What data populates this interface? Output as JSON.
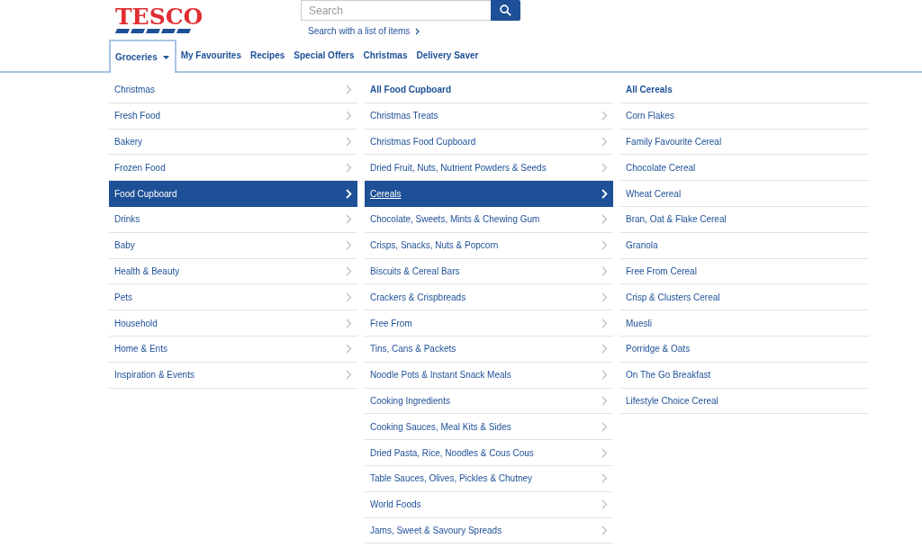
{
  "logo": "TESCO",
  "search": {
    "placeholder": "Search",
    "list_link": "Search with a list of items"
  },
  "nav": [
    {
      "label": "Groceries",
      "selected": true,
      "dropdown": true
    },
    {
      "label": "My Favourites",
      "selected": false,
      "dropdown": false
    },
    {
      "label": "Recipes",
      "selected": false,
      "dropdown": false
    },
    {
      "label": "Special Offers",
      "selected": false,
      "dropdown": false
    },
    {
      "label": "Christmas",
      "selected": false,
      "dropdown": false
    },
    {
      "label": "Delivery Saver",
      "selected": false,
      "dropdown": false
    }
  ],
  "columns": [
    {
      "items": [
        {
          "label": "Christmas",
          "kind": "category",
          "selected": false
        },
        {
          "label": "Fresh Food",
          "kind": "category",
          "selected": false
        },
        {
          "label": "Bakery",
          "kind": "category",
          "selected": false
        },
        {
          "label": "Frozen Food",
          "kind": "category",
          "selected": false
        },
        {
          "label": "Food Cupboard",
          "kind": "category",
          "selected": true
        },
        {
          "label": "Drinks",
          "kind": "category",
          "selected": false
        },
        {
          "label": "Baby",
          "kind": "category",
          "selected": false
        },
        {
          "label": "Health & Beauty",
          "kind": "category",
          "selected": false
        },
        {
          "label": "Pets",
          "kind": "category",
          "selected": false
        },
        {
          "label": "Household",
          "kind": "category",
          "selected": false
        },
        {
          "label": "Home & Ents",
          "kind": "category",
          "selected": false
        },
        {
          "label": "Inspiration & Events",
          "kind": "category",
          "selected": false
        }
      ]
    },
    {
      "items": [
        {
          "label": "All Food Cupboard",
          "kind": "all",
          "selected": false
        },
        {
          "label": "Christmas Treats",
          "kind": "category",
          "selected": false
        },
        {
          "label": "Christmas Food Cupboard",
          "kind": "category",
          "selected": false
        },
        {
          "label": "Dried Fruit, Nuts, Nutrient Powders & Seeds",
          "kind": "category",
          "selected": false
        },
        {
          "label": "Cereals",
          "kind": "category",
          "selected": true
        },
        {
          "label": "Chocolate, Sweets, Mints & Chewing Gum",
          "kind": "category",
          "selected": false
        },
        {
          "label": "Crisps, Snacks, Nuts & Popcorn",
          "kind": "category",
          "selected": false
        },
        {
          "label": "Biscuits & Cereal Bars",
          "kind": "category",
          "selected": false
        },
        {
          "label": "Crackers & Crispbreads",
          "kind": "category",
          "selected": false
        },
        {
          "label": "Free From",
          "kind": "category",
          "selected": false
        },
        {
          "label": "Tins, Cans & Packets",
          "kind": "category",
          "selected": false
        },
        {
          "label": "Noodle Pots & Instant Snack Meals",
          "kind": "category",
          "selected": false
        },
        {
          "label": "Cooking Ingredients",
          "kind": "category",
          "selected": false
        },
        {
          "label": "Cooking Sauces, Meal Kits & Sides",
          "kind": "category",
          "selected": false
        },
        {
          "label": "Dried Pasta, Rice, Noodles & Cous Cous",
          "kind": "category",
          "selected": false
        },
        {
          "label": "Table Sauces, Olives, Pickles & Chutney",
          "kind": "category",
          "selected": false
        },
        {
          "label": "World Foods",
          "kind": "category",
          "selected": false
        },
        {
          "label": "Jams, Sweet & Savoury Spreads",
          "kind": "category",
          "selected": false
        }
      ]
    },
    {
      "items": [
        {
          "label": "All Cereals",
          "kind": "all",
          "selected": false
        },
        {
          "label": "Corn Flakes",
          "kind": "leaf",
          "selected": false
        },
        {
          "label": "Family Favourite Cereal",
          "kind": "leaf",
          "selected": false
        },
        {
          "label": "Chocolate Cereal",
          "kind": "leaf",
          "selected": false
        },
        {
          "label": "Wheat Cereal",
          "kind": "leaf",
          "selected": false
        },
        {
          "label": "Bran, Oat & Flake Cereal",
          "kind": "leaf",
          "selected": false
        },
        {
          "label": "Granola",
          "kind": "leaf",
          "selected": false
        },
        {
          "label": "Free From Cereal",
          "kind": "leaf",
          "selected": false
        },
        {
          "label": "Crisp & Clusters Cereal",
          "kind": "leaf",
          "selected": false
        },
        {
          "label": "Muesli",
          "kind": "leaf",
          "selected": false
        },
        {
          "label": "Porridge & Oats",
          "kind": "leaf",
          "selected": false
        },
        {
          "label": "On The Go Breakfast",
          "kind": "leaf",
          "selected": false
        },
        {
          "label": "Lifestyle Choice Cereal",
          "kind": "leaf",
          "selected": false
        }
      ]
    }
  ]
}
